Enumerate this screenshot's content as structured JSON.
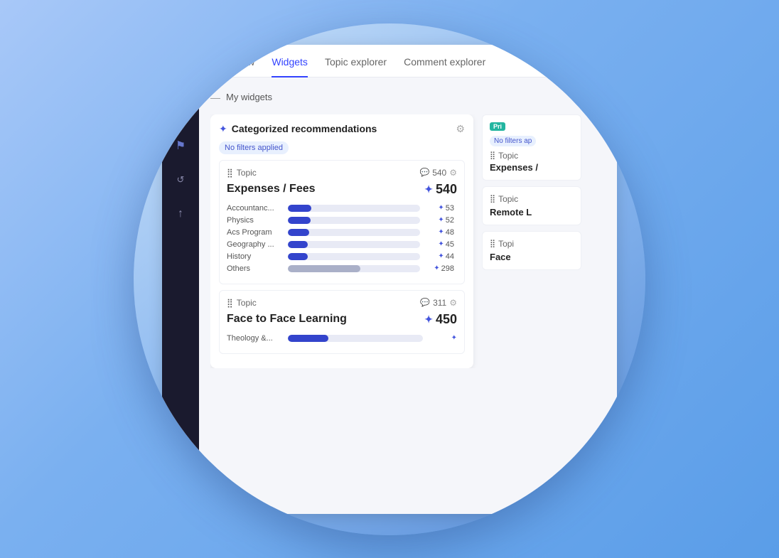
{
  "tabs": [
    {
      "label": "Overview",
      "active": false
    },
    {
      "label": "Widgets",
      "active": true
    },
    {
      "label": "Topic explorer",
      "active": false
    },
    {
      "label": "Comment explorer",
      "active": false
    }
  ],
  "my_widgets": {
    "label": "My widgets"
  },
  "main_widget": {
    "icon": "✦",
    "title": "Categorized recommendations",
    "filter": "No filters applied",
    "gear_label": "⚙",
    "sections": [
      {
        "label": "Topic",
        "count": "540",
        "title": "Expenses / Fees",
        "title_value": "540",
        "bars": [
          {
            "label": "Accountanc...",
            "value": 53,
            "max": 298,
            "type": "blue"
          },
          {
            "label": "Physics",
            "value": 52,
            "max": 298,
            "type": "blue"
          },
          {
            "label": "Acs Program",
            "value": 48,
            "max": 298,
            "type": "blue"
          },
          {
            "label": "Geography ...",
            "value": 45,
            "max": 298,
            "type": "blue"
          },
          {
            "label": "History",
            "value": 44,
            "max": 298,
            "type": "blue"
          },
          {
            "label": "Others",
            "value": 298,
            "max": 298,
            "type": "gray"
          }
        ]
      },
      {
        "label": "Topic",
        "count": "311",
        "title": "Face to Face Learning",
        "title_value": "450",
        "bars": [
          {
            "label": "Theology &...",
            "value": 60,
            "max": 200,
            "type": "blue"
          }
        ]
      }
    ]
  },
  "right_panel": {
    "cards": [
      {
        "badge": "Pri",
        "filter": "No filters ap",
        "label": "Topic",
        "sublabel": "Expenses /",
        "show_filter": true
      },
      {
        "label": "Topic",
        "sublabel": "Remote L",
        "show_filter": false
      },
      {
        "label": "Topi",
        "sublabel": "Face",
        "show_filter": false
      }
    ]
  },
  "sidebar": {
    "logo_bars": [
      8,
      12,
      16
    ],
    "icons": [
      "⌂",
      "⚑",
      "↺",
      "↑"
    ]
  }
}
